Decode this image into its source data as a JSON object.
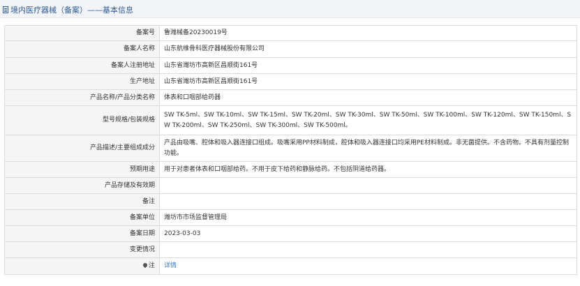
{
  "header": {
    "title": "境内医疗器械（备案）——基本信息"
  },
  "rows": [
    {
      "label": "备案号",
      "value": "鲁潍械备20230019号"
    },
    {
      "label": "备案人名称",
      "value": "山东航维骨科医疗器械股份有限公司"
    },
    {
      "label": "备案人注册地址",
      "value": "山东省潍坊市高新区昌顺街161号"
    },
    {
      "label": "生产地址",
      "value": "山东省潍坊市高新区昌顺街161号"
    },
    {
      "label": "产品名称/产品分类名称",
      "value": "体表和口咽部给药器"
    },
    {
      "label": "型号规格/包装规格",
      "value": "SW TK-5ml、SW TK-10ml、SW TK-15ml、SW TK-20ml、SW TK-30ml、SW TK-50ml、SW TK-100ml、SW TK-120ml、SW TK-150ml、SW TK-200ml、SW TK-250ml、SW TK-300ml、SW TK-500ml。"
    },
    {
      "label": "产品描述/主要组成成分",
      "value": "产品由吸嘴、腔体和吸入器连接口组成。吸嘴采用PP材料制成，腔体和吸入器连接口均采用PE材料制成。非无菌提供。不含药物。不具有剂量控制功能。"
    },
    {
      "label": "预期用途",
      "value": "用于对患者体表和口咽部给药。不用于皮下给药和静脉给药。不包括阴道给药器。"
    },
    {
      "label": "产品存储及有效期",
      "value": ""
    },
    {
      "label": "备注",
      "value": ""
    },
    {
      "label": "备案单位",
      "value": "潍坊市市场监督管理局"
    },
    {
      "label": "备案日期",
      "value": "2023-03-03"
    },
    {
      "label": "变更情况",
      "value": ""
    },
    {
      "label": "注",
      "value": "详情"
    }
  ]
}
